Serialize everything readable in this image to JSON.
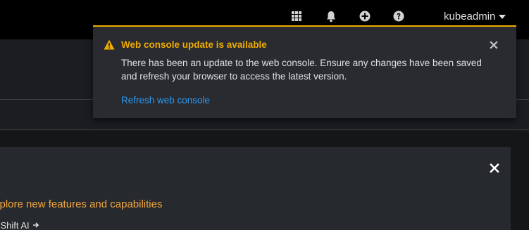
{
  "masthead": {
    "icons": [
      "grid-icon",
      "bell-icon",
      "plus-circle-icon",
      "question-circle-icon"
    ],
    "user_label": "kubeadmin"
  },
  "alert": {
    "title": "Web console update is available",
    "description": "There has been an update to the web console. Ensure any changes have been saved and refresh your browser to access the latest version.",
    "action_label": "Refresh web console",
    "accent_color": "#f0ab00",
    "link_color": "#2b9af3"
  },
  "card": {
    "title": "xplore new features and capabilities",
    "link_label": "enShift AI",
    "title_color": "#f4a640"
  }
}
